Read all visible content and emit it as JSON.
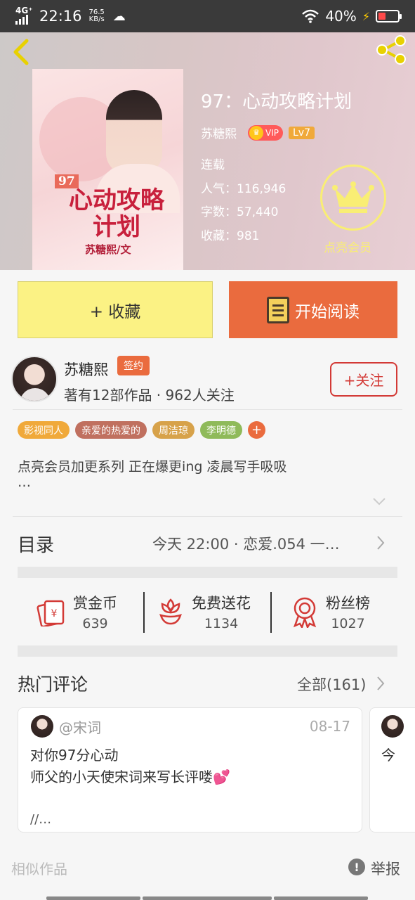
{
  "status_bar": {
    "network": "4G⁺",
    "time": "22:16",
    "speed_value": "76.5",
    "speed_unit": "KB/s",
    "battery_text": "40%",
    "battery_level": 0.4
  },
  "book": {
    "title": "97：心动攻略计划",
    "author": "苏糖熙",
    "vip_label": "VIP",
    "level": "Lv7",
    "status": "连载",
    "popularity": "人气：116,946",
    "word_count": "字数：57,440",
    "favorites": "收藏：981",
    "member_label": "点亮会员",
    "cover": {
      "number": "97",
      "title_line1": "心动攻略",
      "title_line2": "计划",
      "author": "苏糖熙/文"
    }
  },
  "actions": {
    "collect_label": "+ 收藏",
    "read_label": "开始阅读"
  },
  "author": {
    "name": "苏糖熙",
    "signed_badge": "签约",
    "stats": "著有12部作品 · 962人关注",
    "follow_label": "+关注"
  },
  "tags": [
    {
      "label": "影视同人",
      "color": "#f0a93a"
    },
    {
      "label": "亲爱的热爱的",
      "color": "#c0705f"
    },
    {
      "label": "周洁琼",
      "color": "#d7a24a"
    },
    {
      "label": "李明德",
      "color": "#8fba5a"
    }
  ],
  "description": {
    "line1": "点亮会员加更系列 正在爆更ing 凌晨写手吸吸",
    "line2": "…"
  },
  "toc": {
    "label": "目录",
    "latest": "今天 22:00 · 恋爱.054 一…"
  },
  "stats": {
    "coins_label": "赏金币",
    "coins_value": "639",
    "flowers_label": "免费送花",
    "flowers_value": "1134",
    "fans_label": "粉丝榜",
    "fans_value": "1027"
  },
  "comments": {
    "title": "热门评论",
    "all_label": "全部(161)",
    "items": [
      {
        "user": "@宋词",
        "date": "08-17",
        "line1": "对你97分心动",
        "line2": "师父的小天使宋词来写长评喽💕",
        "more": "//…"
      },
      {
        "user": "",
        "date": "",
        "line1": "今",
        "line2": "",
        "more": ""
      }
    ]
  },
  "footer": {
    "similar_label": "相似作品",
    "report_label": "举报"
  },
  "colors": {
    "accent_orange": "#ea6b3e",
    "collect_yellow": "#fbf284",
    "follow_red": "#d33a36",
    "crown_yellow": "#f9ee74"
  },
  "icons": [
    "back-icon",
    "share-icon",
    "crown-icon",
    "book-icon",
    "red-envelope-icon",
    "flower-icon",
    "medal-icon",
    "chevron-right-icon",
    "chevron-down-icon",
    "report-icon"
  ]
}
